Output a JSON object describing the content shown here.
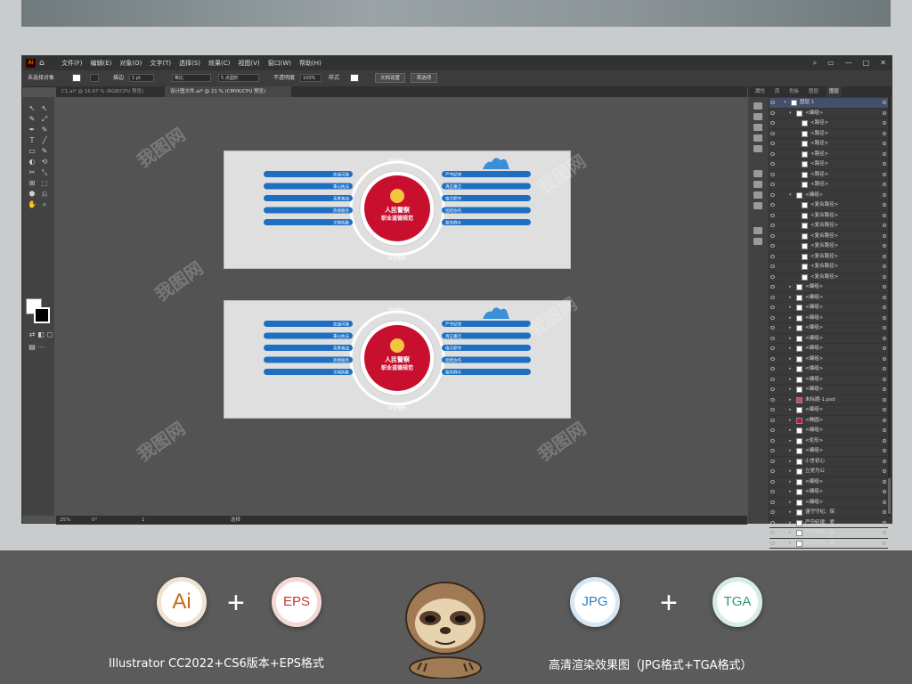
{
  "menubar": {
    "menus": [
      "文件(F)",
      "编辑(E)",
      "对象(O)",
      "文字(T)",
      "选择(S)",
      "效果(C)",
      "视图(V)",
      "窗口(W)",
      "帮助(H)"
    ]
  },
  "control_bar": {
    "selection": "未选择对象",
    "stroke_label": "描边",
    "stroke_value": "1 pt",
    "uniform": "等比",
    "brush": "5 点圆形",
    "opacity_label": "不透明度",
    "opacity_value": "100%",
    "style_label": "样式",
    "doc_setup": "文档设置",
    "preferences": "首选项"
  },
  "tabs": [
    {
      "label": "C1.ai* @ 16.67 % (RGB/CPU 预览)"
    },
    {
      "label": "设计图文件.ai* @ 21 % (CMYK/CPU 预览)"
    }
  ],
  "status": {
    "zoom": "25%",
    "angle": "0°",
    "page": "1",
    "mode": "选择"
  },
  "panel": {
    "tabs": [
      "属性",
      "库",
      "色板",
      "图层",
      "图层"
    ],
    "layers": [
      {
        "name": "图层 1",
        "indent": 0,
        "sel": true
      },
      {
        "name": "<编组>",
        "indent": 1
      },
      {
        "name": "<路径>",
        "indent": 2
      },
      {
        "name": "<路径>",
        "indent": 2
      },
      {
        "name": "<路径>",
        "indent": 2
      },
      {
        "name": "<路径>",
        "indent": 2
      },
      {
        "name": "<路径>",
        "indent": 2
      },
      {
        "name": "<路径>",
        "indent": 2
      },
      {
        "name": "<路径>",
        "indent": 2
      },
      {
        "name": "<编组>",
        "indent": 1
      },
      {
        "name": "<复合路径>",
        "indent": 2
      },
      {
        "name": "<复合路径>",
        "indent": 2
      },
      {
        "name": "<复合路径>",
        "indent": 2
      },
      {
        "name": "<复合路径>",
        "indent": 2
      },
      {
        "name": "<复合路径>",
        "indent": 2
      },
      {
        "name": "<复合路径>",
        "indent": 2
      },
      {
        "name": "<复合路径>",
        "indent": 2
      },
      {
        "name": "<复合路径>",
        "indent": 2
      },
      {
        "name": "<编组>",
        "indent": 1
      },
      {
        "name": "<编组>",
        "indent": 1
      },
      {
        "name": "<编组>",
        "indent": 1
      },
      {
        "name": "<编组>",
        "indent": 1
      },
      {
        "name": "<编组>",
        "indent": 1
      },
      {
        "name": "<编组>",
        "indent": 1
      },
      {
        "name": "<编组>",
        "indent": 1
      },
      {
        "name": "<编组>",
        "indent": 1
      },
      {
        "name": "<编组>",
        "indent": 1
      },
      {
        "name": "<编组>",
        "indent": 1
      },
      {
        "name": "<编组>",
        "indent": 1
      },
      {
        "name": "未标题-1.psd",
        "indent": 1
      },
      {
        "name": "<编组>",
        "indent": 1
      },
      {
        "name": "<椭圆>",
        "indent": 1
      },
      {
        "name": "<编组>",
        "indent": 1
      },
      {
        "name": "<矩形>",
        "indent": 1
      },
      {
        "name": "<编组>",
        "indent": 1
      },
      {
        "name": "小言初心",
        "indent": 1
      },
      {
        "name": "立党为公",
        "indent": 1
      },
      {
        "name": "<编组>",
        "indent": 1
      },
      {
        "name": "<编组>",
        "indent": 1
      },
      {
        "name": "<编组>",
        "indent": 1
      },
      {
        "name": "谨守守纪、保",
        "indent": 1
      },
      {
        "name": "严守纪律、爱",
        "indent": 1
      },
      {
        "name": "热忱服务、热",
        "indent": 1
      },
      {
        "name": "忠诚可靠、爱",
        "indent": 1
      },
      {
        "name": "<编组>",
        "indent": 1
      }
    ]
  },
  "artwork": {
    "emblem_title": "人民警察",
    "emblem_subtitle": "职业道德规范",
    "left_items": [
      {
        "text": "忠诚可靠",
        "label": "忠诚可靠"
      },
      {
        "text": "秉公执法",
        "label": "秉公执法"
      },
      {
        "text": "英勇善战",
        "label": "英勇善战"
      },
      {
        "text": "热情服务",
        "label": "热情服务"
      },
      {
        "text": "文明执勤",
        "label": "文明执勤"
      }
    ],
    "right_items": [
      {
        "label": "严守纪律"
      },
      {
        "label": "清正廉洁"
      },
      {
        "label": "恪尽职守"
      },
      {
        "label": "团结协作"
      },
      {
        "label": "服务群众"
      }
    ],
    "top_text": "不忘初心",
    "bottom_text": "牢记使命",
    "colors": {
      "blue": "#1e6fc2",
      "red": "#c8102e"
    }
  },
  "footer": {
    "badges": [
      "Ai",
      "EPS",
      "JPG",
      "TGA"
    ],
    "plus": "+",
    "caption_left": "Illustrator CC2022+CS6版本+EPS格式",
    "caption_right": "高清渲染效果图（JPG格式+TGA格式）",
    "colors": {
      "ai": "#c46a1c",
      "eps": "#d0342b",
      "jpg": "#2a83c8",
      "tga": "#2f9c72"
    }
  },
  "watermark": "我图网"
}
